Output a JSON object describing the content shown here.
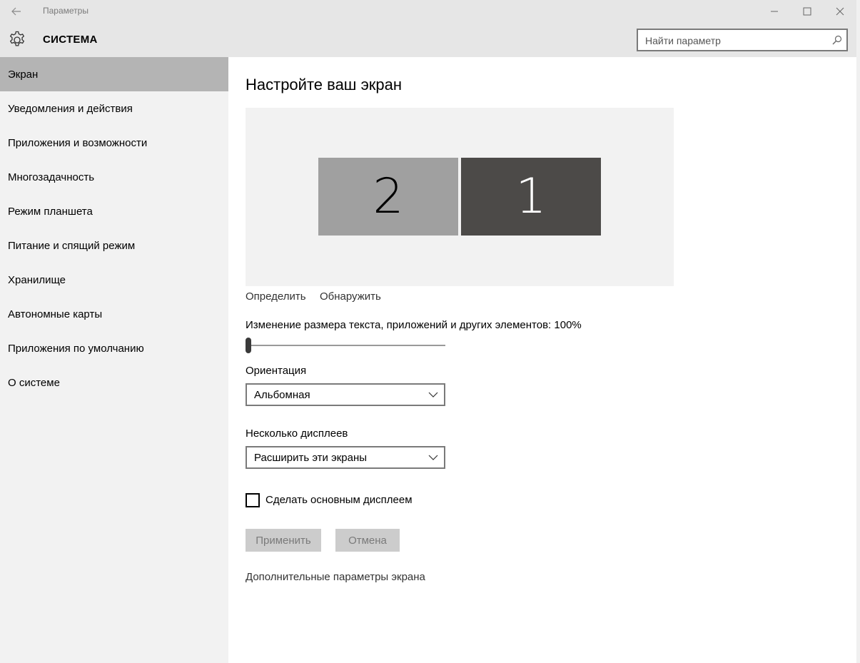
{
  "window": {
    "title": "Параметры",
    "minimize": "—",
    "maximize": "☐",
    "close": "✕"
  },
  "header": {
    "section_title": "СИСТЕМА",
    "search_placeholder": "Найти параметр"
  },
  "sidebar": {
    "items": [
      {
        "label": "Экран",
        "active": true
      },
      {
        "label": "Уведомления и действия"
      },
      {
        "label": "Приложения и возможности"
      },
      {
        "label": "Многозадачность"
      },
      {
        "label": "Режим планшета"
      },
      {
        "label": "Питание и спящий режим"
      },
      {
        "label": "Хранилище"
      },
      {
        "label": "Автономные карты"
      },
      {
        "label": "Приложения по умолчанию"
      },
      {
        "label": "О системе"
      }
    ]
  },
  "main": {
    "title": "Настройте ваш экран",
    "monitors": [
      {
        "number": "2",
        "color": "#a0a0a0"
      },
      {
        "number": "1",
        "color": "#4c4a48",
        "selected": true
      }
    ],
    "identify_link": "Определить",
    "detect_link": "Обнаружить",
    "scale_label": "Изменение размера текста, приложений и других элементов: 100%",
    "scale_percent": 100,
    "orientation_label": "Ориентация",
    "orientation_value": "Альбомная",
    "multi_display_label": "Несколько дисплеев",
    "multi_display_value": "Расширить эти экраны",
    "make_main_label": "Сделать основным дисплеем",
    "make_main_checked": false,
    "apply_label": "Применить",
    "cancel_label": "Отмена",
    "advanced_link": "Дополнительные параметры экрана"
  }
}
